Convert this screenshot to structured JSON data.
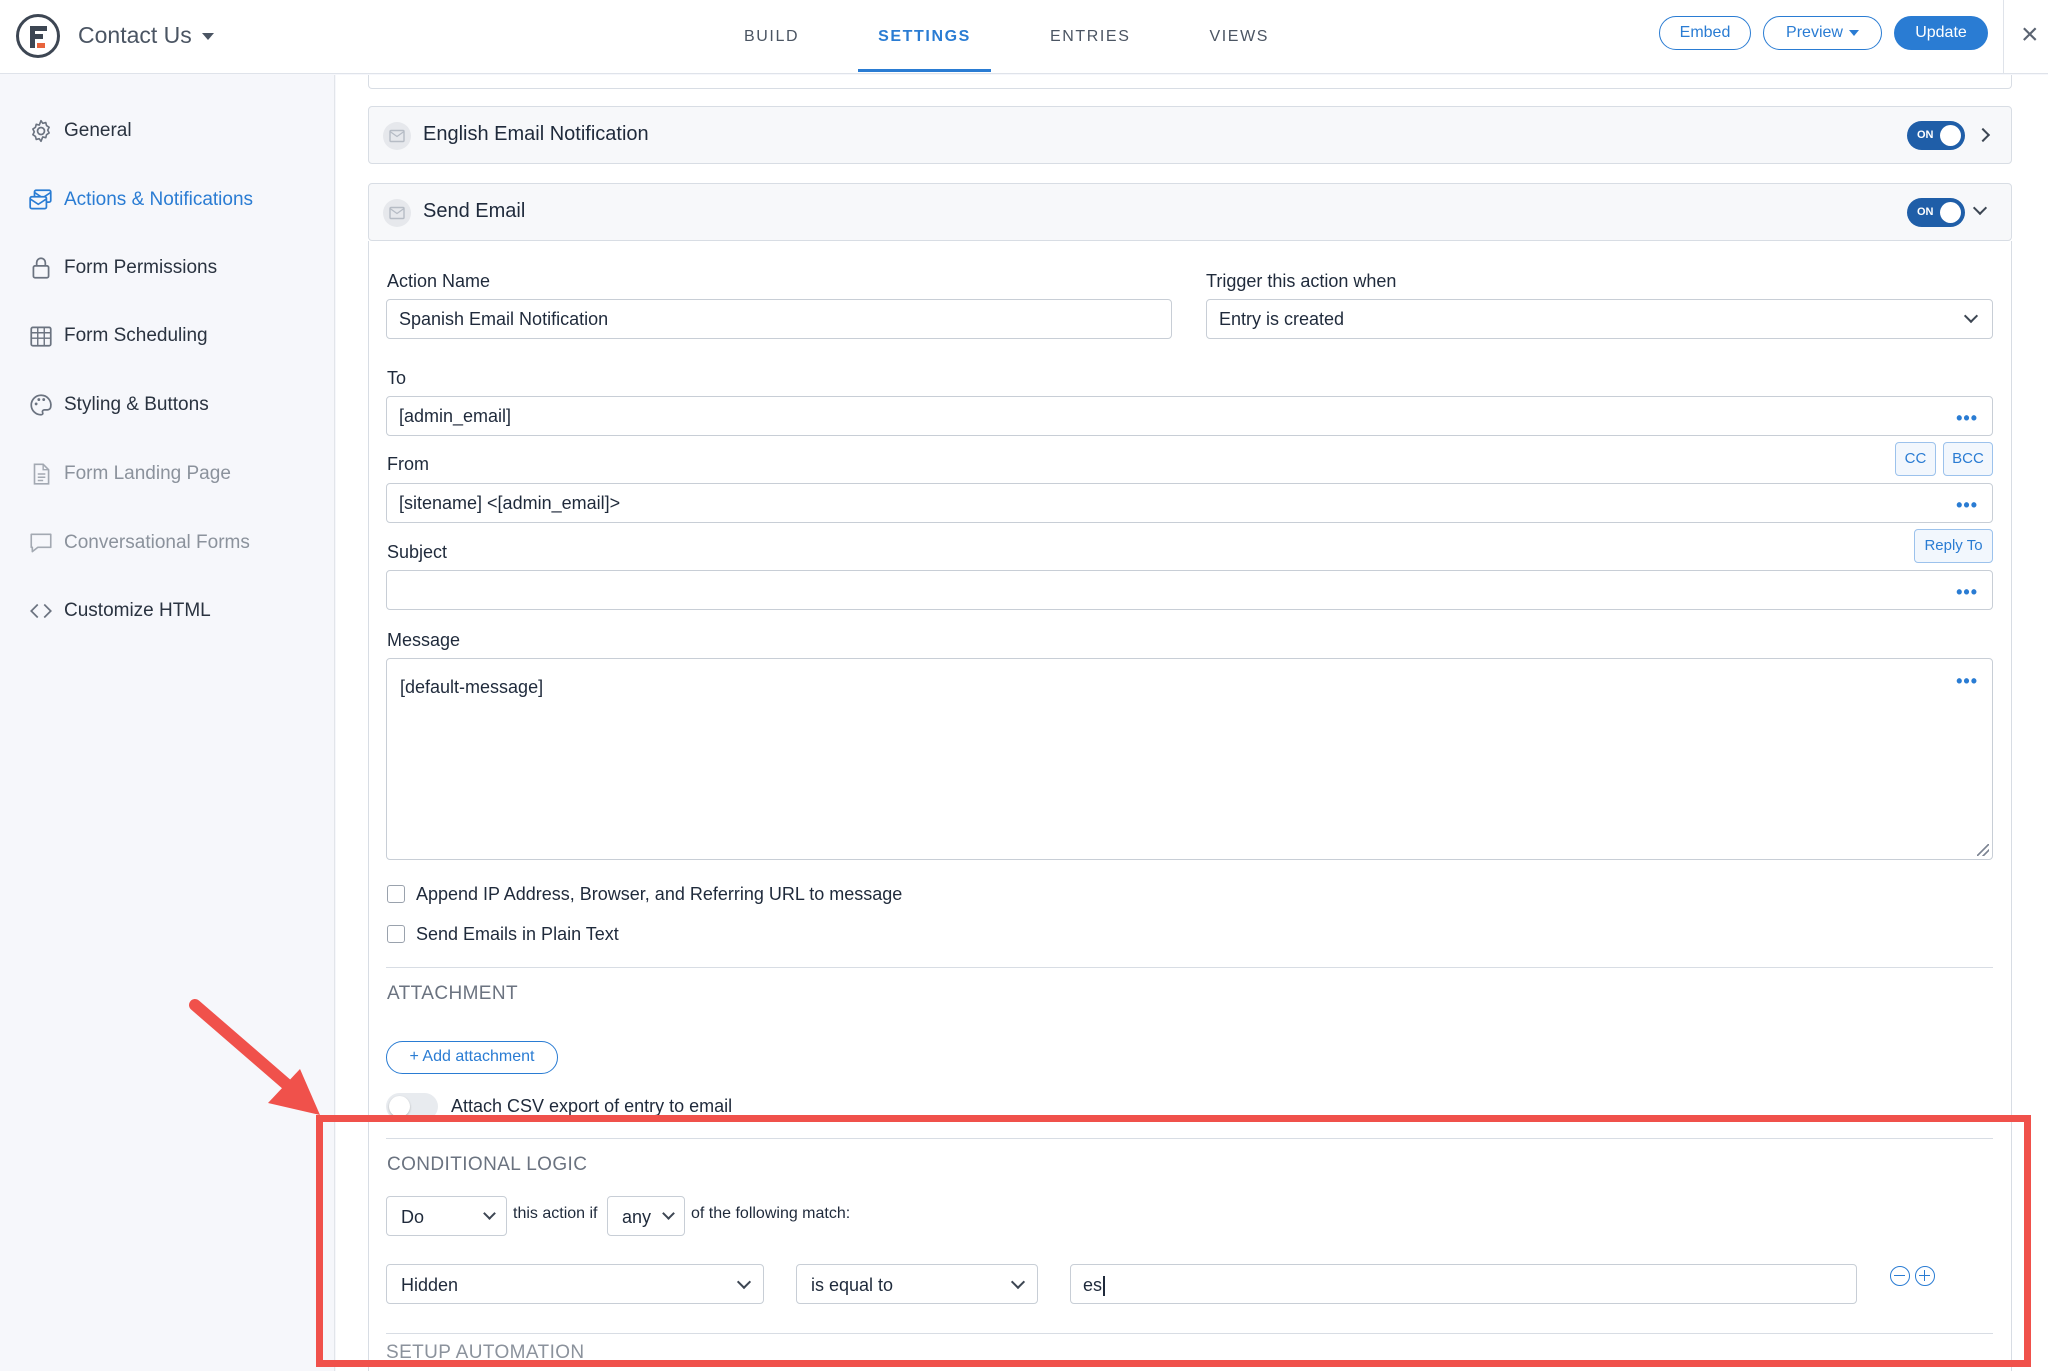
{
  "header": {
    "form_title": "Contact Us",
    "tabs": [
      "BUILD",
      "SETTINGS",
      "ENTRIES",
      "VIEWS"
    ],
    "active_tab": "SETTINGS",
    "embed_label": "Embed",
    "preview_label": "Preview",
    "update_label": "Update",
    "close_glyph": "×"
  },
  "sidebar": {
    "items": [
      {
        "label": "General",
        "icon": "gear-icon",
        "state": "normal"
      },
      {
        "label": "Actions & Notifications",
        "icon": "notifications-icon",
        "state": "active"
      },
      {
        "label": "Form Permissions",
        "icon": "lock-icon",
        "state": "normal"
      },
      {
        "label": "Form Scheduling",
        "icon": "calendar-grid-icon",
        "state": "normal"
      },
      {
        "label": "Styling & Buttons",
        "icon": "palette-icon",
        "state": "normal"
      },
      {
        "label": "Form Landing Page",
        "icon": "page-icon",
        "state": "muted"
      },
      {
        "label": "Conversational Forms",
        "icon": "chat-bubble-icon",
        "state": "muted"
      },
      {
        "label": "Customize HTML",
        "icon": "code-icon",
        "state": "normal"
      }
    ]
  },
  "actions": [
    {
      "title": "English Email Notification",
      "toggle_label": "ON",
      "expanded": false
    },
    {
      "title": "Send Email",
      "toggle_label": "ON",
      "expanded": true
    }
  ],
  "form": {
    "action_name_label": "Action Name",
    "action_name_value": "Spanish Email Notification",
    "trigger_label": "Trigger this action when",
    "trigger_value": "Entry is created",
    "to_label": "To",
    "to_value": "[admin_email]",
    "from_label": "From",
    "from_value": "[sitename] <[admin_email]>",
    "cc_label": "CC",
    "bcc_label": "BCC",
    "subject_label": "Subject",
    "subject_value": "",
    "reply_to_label": "Reply To",
    "message_label": "Message",
    "message_value": "[default-message]",
    "dots_glyph": "•••",
    "append_ip_label": "Append IP Address, Browser, and Referring URL to message",
    "plain_text_label": "Send Emails in Plain Text"
  },
  "attachment": {
    "section_title": "ATTACHMENT",
    "add_label": "+ Add attachment",
    "csv_label": "Attach CSV export of entry to email"
  },
  "conditional": {
    "section_title": "CONDITIONAL LOGIC",
    "do_value": "Do",
    "this_action_if": "this action if",
    "any_value": "any",
    "of_following": "of the following match:",
    "field_value": "Hidden",
    "operator_value": "is equal to",
    "compare_value": "es"
  },
  "next_section_title": "SETUP AUTOMATION",
  "colors": {
    "accent": "#2a7cd3",
    "toggle_on": "#1f5ea8",
    "highlight": "#f0514b"
  }
}
